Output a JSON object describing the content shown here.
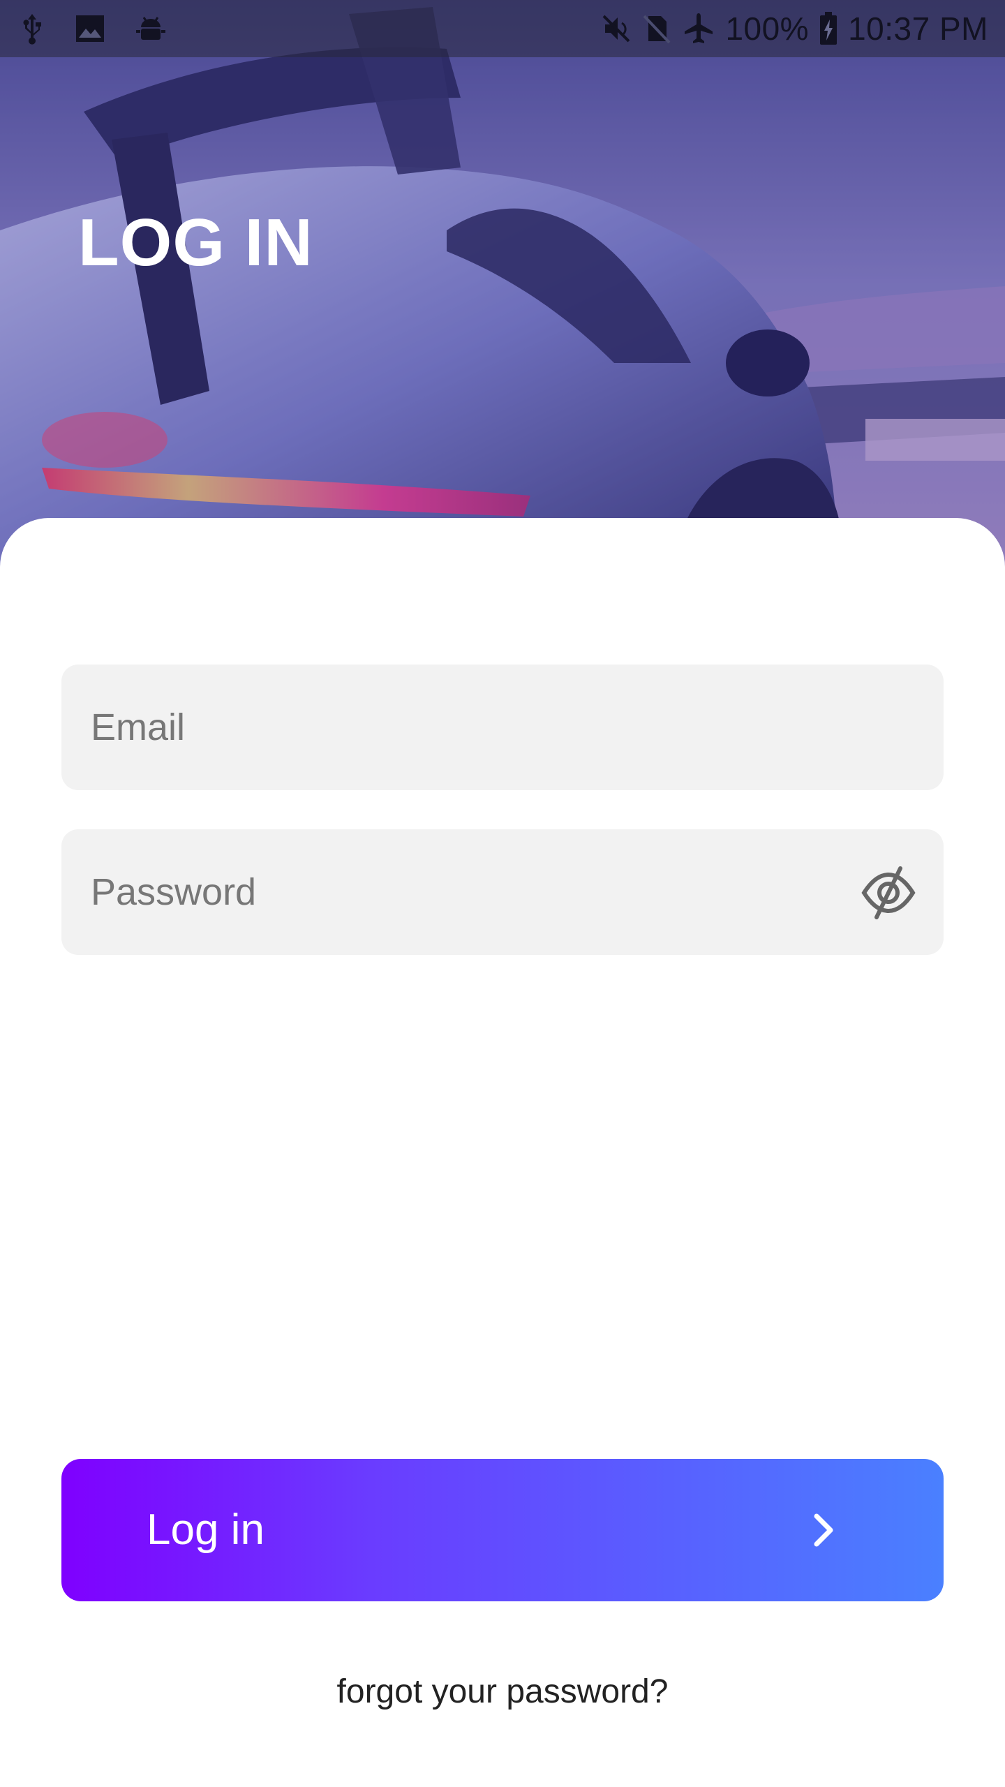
{
  "status_bar": {
    "left_icons": [
      "usb-icon",
      "image-icon",
      "android-debug-icon"
    ],
    "right_icons": [
      "mute-icon",
      "no-sim-icon",
      "airplane-icon",
      "battery-charging-icon"
    ],
    "battery": "100%",
    "time": "10:37 PM"
  },
  "header": {
    "title": "LOG IN"
  },
  "form": {
    "email_placeholder": "Email",
    "email_value": "",
    "password_placeholder": "Password",
    "password_value": "",
    "visibility_icon": "eye-off-icon"
  },
  "actions": {
    "login_label": "Log in",
    "login_icon": "chevron-right-icon",
    "forgot_label": "forgot your password?"
  },
  "colors": {
    "button_gradient_start": "#7f00ff",
    "button_gradient_end": "#4a80ff",
    "field_background": "#f2f2f2",
    "title_color": "#ffffff"
  }
}
